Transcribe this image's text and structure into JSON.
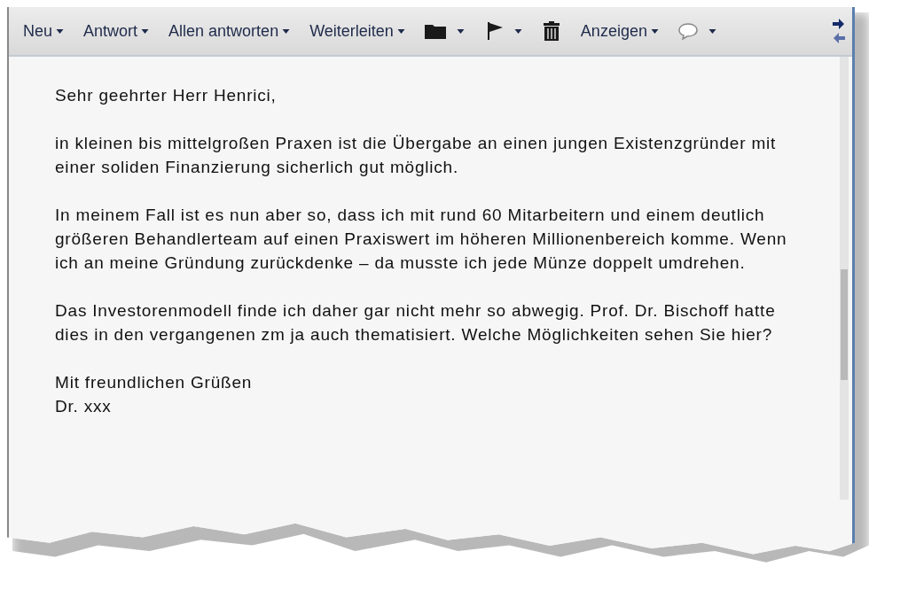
{
  "toolbar": [
    {
      "kind": "menu",
      "label": "Neu"
    },
    {
      "kind": "menu",
      "label": "Antwort"
    },
    {
      "kind": "menu",
      "label": "Allen antworten"
    },
    {
      "kind": "menu",
      "label": "Weiterleiten"
    },
    {
      "kind": "folder"
    },
    {
      "kind": "flag"
    },
    {
      "kind": "trash"
    },
    {
      "kind": "menu",
      "label": "Anzeigen"
    },
    {
      "kind": "bubble"
    }
  ],
  "message": {
    "paragraphs": [
      {
        "lines": [
          "Sehr geehrter Herr Henrici,"
        ]
      },
      {
        "lines": [
          "in kleinen bis mittelgroßen Praxen ist die Übergabe an einen jungen Existenzgründer mit",
          "einer soliden Finanzierung sicherlich gut möglich."
        ]
      },
      {
        "lines": [
          "In meinem Fall ist es nun aber so, dass ich mit rund 60 Mitarbeitern und einem deutlich",
          "größeren Behandlerteam auf einen Praxiswert im höheren Millionenbereich komme. Wenn",
          "ich an meine Gründung zurückdenke – da musste ich jede Münze doppelt umdrehen."
        ]
      },
      {
        "lines": [
          "Das Investorenmodell finde ich daher gar nicht mehr so abwegig. Prof. Dr. Bischoff hatte",
          "dies in den vergangenen zm ja auch thematisiert. Welche Möglichkeiten sehen Sie hier?"
        ]
      },
      {
        "lines": [
          "Mit freundlichen Grüßen",
          "Dr. xxx"
        ]
      }
    ]
  }
}
